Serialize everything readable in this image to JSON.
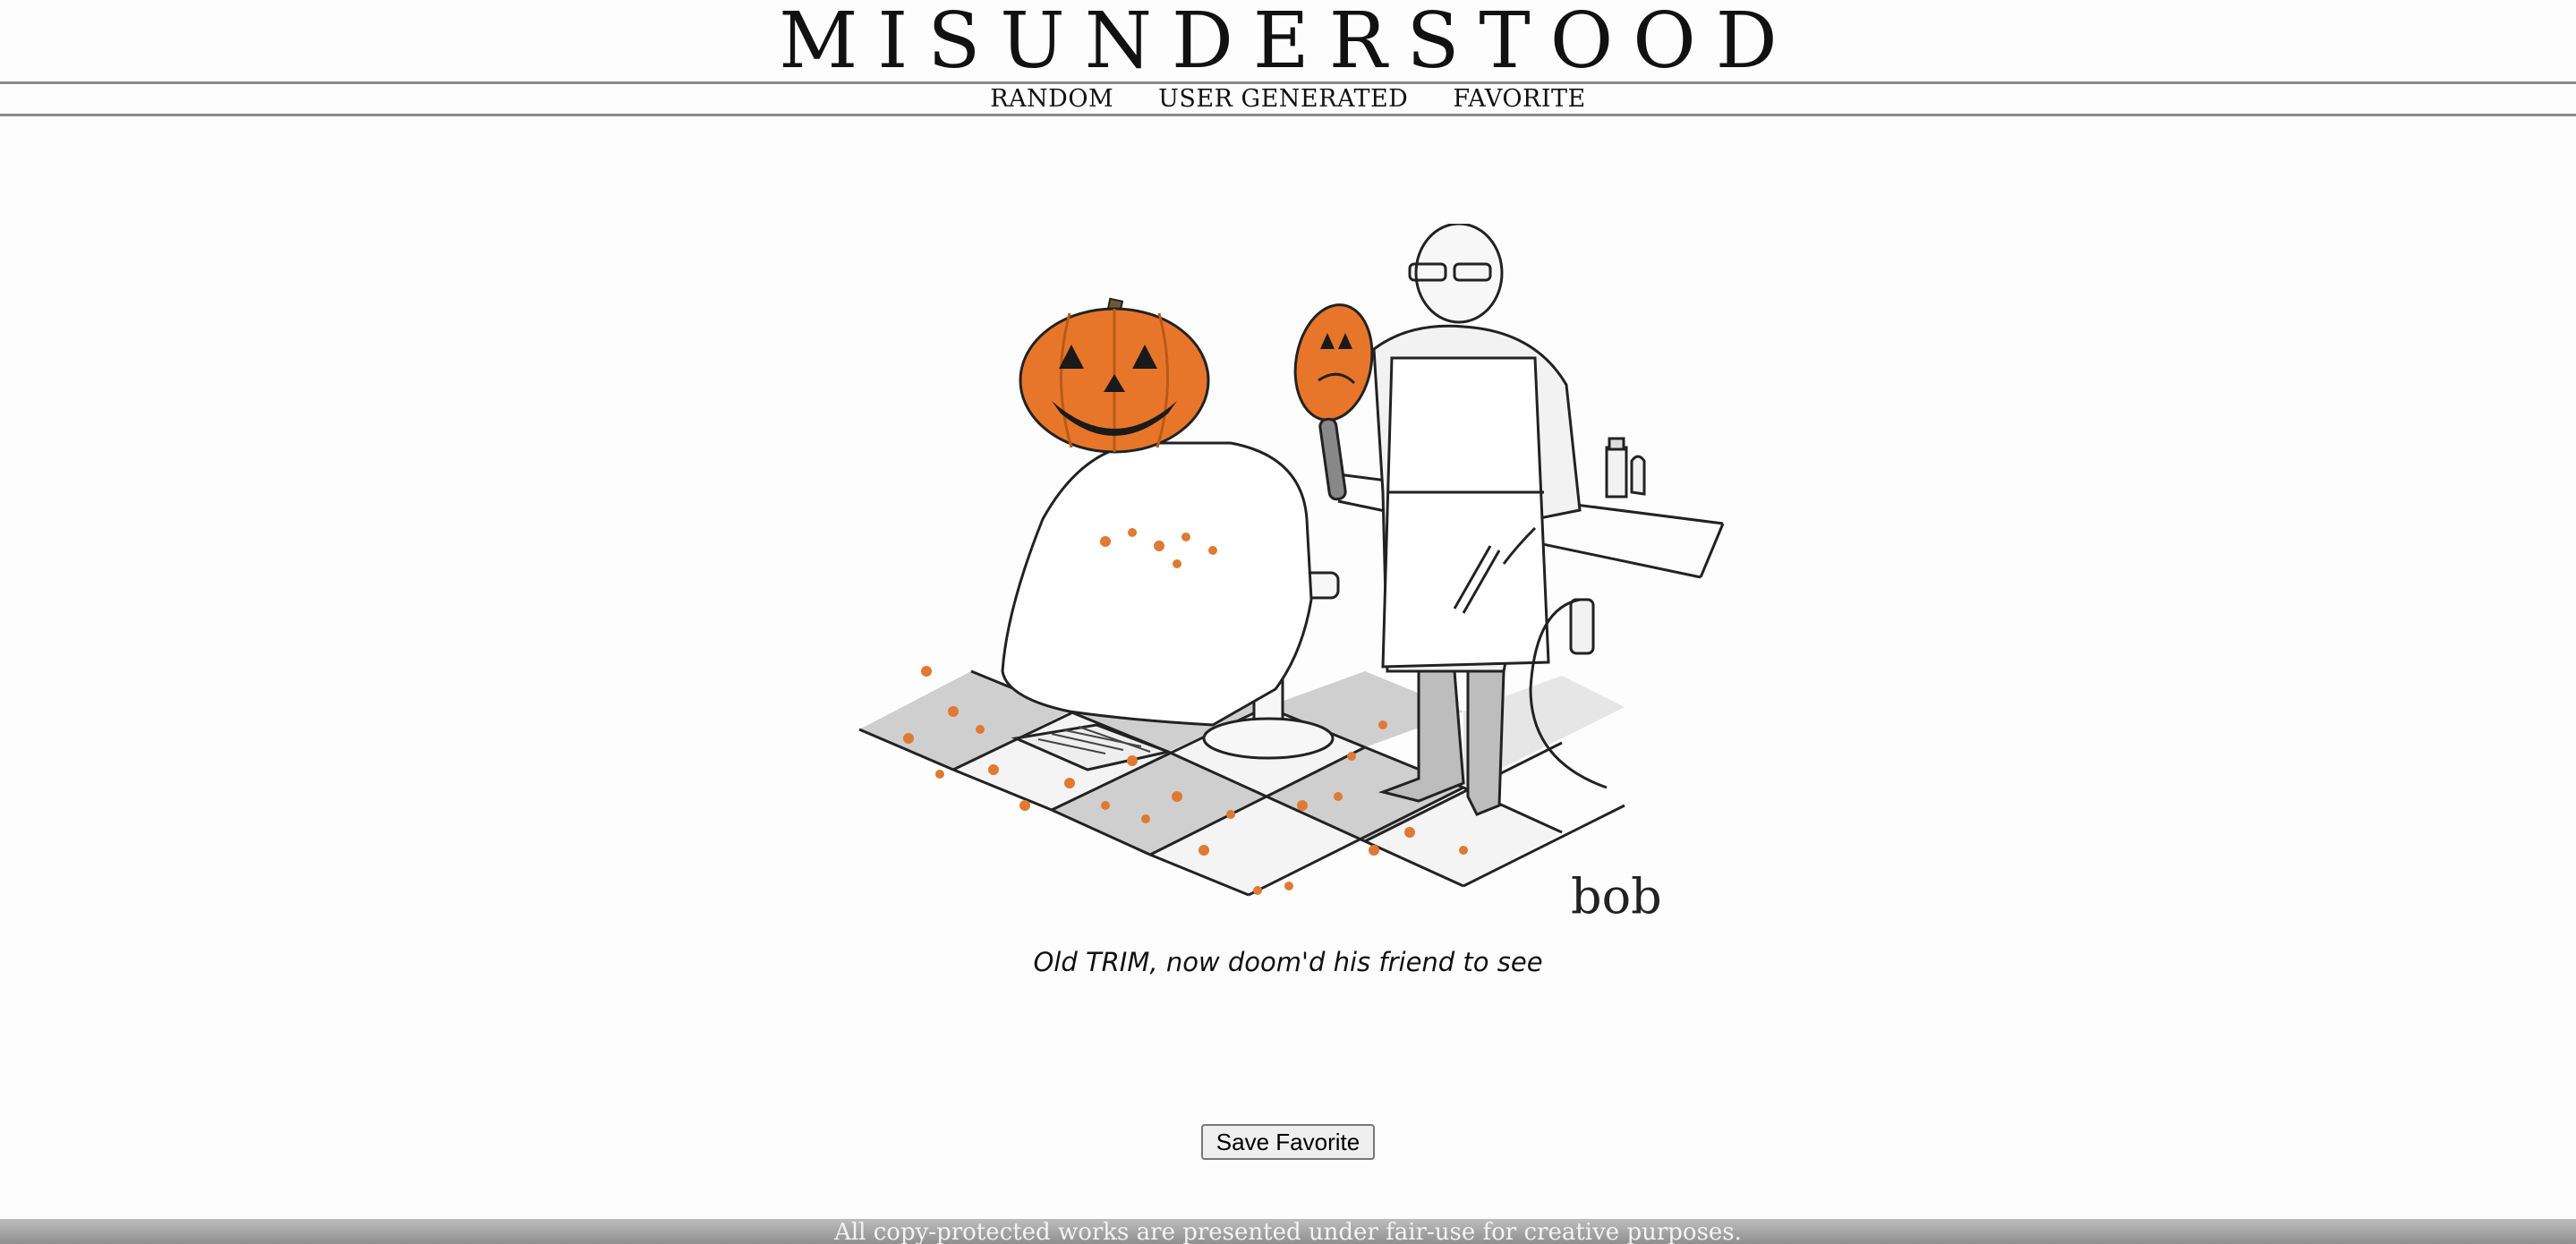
{
  "site": {
    "title": "MISUNDERSTOOD"
  },
  "nav": {
    "random": "RANDOM",
    "user_generated": "USER GENERATED",
    "favorite": "FAVORITE"
  },
  "cartoon": {
    "caption": "Old TRIM, now doom'd his friend to see",
    "signature": "bob",
    "colors": {
      "pumpkin": "#e8762a",
      "shadow": "#c9c9c9"
    }
  },
  "actions": {
    "save_favorite": "Save Favorite"
  },
  "footer": {
    "text": "All copy-protected works are presented under fair-use for creative purposes."
  }
}
